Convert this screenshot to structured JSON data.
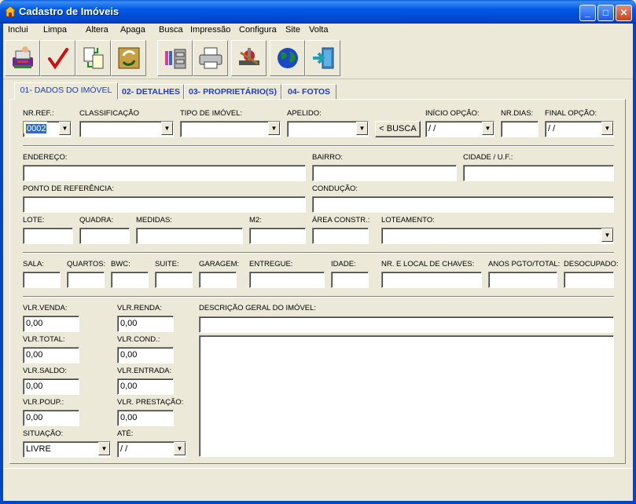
{
  "window": {
    "title": "Cadastro de Imóveis",
    "min": "_",
    "max": "□",
    "close": "✕"
  },
  "menu": [
    "Inclui",
    "Limpa",
    "Altera",
    "Apaga",
    "Busca",
    "Impressão",
    "Configura",
    "Site",
    "Volta"
  ],
  "toolbar_icons": [
    "printer-person-icon",
    "checkmark-icon",
    "documents-icon",
    "refresh-icon",
    "file-cabinet-icon",
    "printer-icon",
    "tools-icon",
    "globe-icon",
    "exit-door-icon"
  ],
  "tabs": [
    "01- DADOS DO IMÓVEL",
    "02- DETALHES",
    "03- PROPRIETÁRIO(S)",
    "04- FOTOS"
  ],
  "labels": {
    "nr_ref": "NR.REF.:",
    "classificacao": "CLASSIFICAÇÃO",
    "tipo": "TIPO DE IMÓVEL:",
    "apelido": "APELIDO:",
    "inicio_opcao": "INÍCIO OPÇÃO:",
    "nr_dias": "NR.DIAS:",
    "final_opcao": "FINAL OPÇÃO:",
    "endereco": "ENDEREÇO:",
    "bairro": "BAIRRO:",
    "cidade": "CIDADE / U.F.:",
    "ponto": "PONTO DE REFERÊNCIA:",
    "conducao": "CONDUÇÃO:",
    "lote": "LOTE:",
    "quadra": "QUADRA:",
    "medidas": "MEDIDAS:",
    "m2": "M2:",
    "area": "ÁREA CONSTR.:",
    "loteamento": "LOTEAMENTO:",
    "sala": "SALA:",
    "quartos": "QUARTOS:",
    "bwc": "BWC:",
    "suite": "SUITE:",
    "garagem": "GARAGEM:",
    "entregue": "ENTREGUE:",
    "idade": "IDADE:",
    "chaves": "NR. E LOCAL DE CHAVES:",
    "anos_pgto": "ANOS PGTO/TOTAL:",
    "desocupado": "DESOCUPADO:",
    "vlr_venda": "VLR.VENDA:",
    "vlr_renda": "VLR.RENDA:",
    "descricao": "DESCRIÇÃO GERAL DO IMÓVEL:",
    "vlr_total": "VLR.TOTAL:",
    "vlr_cond": "VLR.COND.:",
    "vlr_saldo": "VLR.SALDO:",
    "vlr_entrada": "VLR.ENTRADA:",
    "vlr_poup": "VLR.POUP.:",
    "vlr_prestacao": "VLR. PRESTAÇÃO:",
    "situacao": "SITUAÇÃO:",
    "ate": "ATÉ:"
  },
  "values": {
    "nr_ref": "0002",
    "inicio_opcao": " / /",
    "final_opcao": " / /",
    "vlr_venda": "0,00",
    "vlr_renda": "0,00",
    "vlr_total": "0,00",
    "vlr_cond": "0,00",
    "vlr_saldo": "0,00",
    "vlr_entrada": "0,00",
    "vlr_poup": "0,00",
    "vlr_prestacao": "0,00",
    "situacao": "LIVRE",
    "ate": " / /"
  },
  "buttons": {
    "busca": "< BUSCA"
  },
  "arrow": "▼"
}
